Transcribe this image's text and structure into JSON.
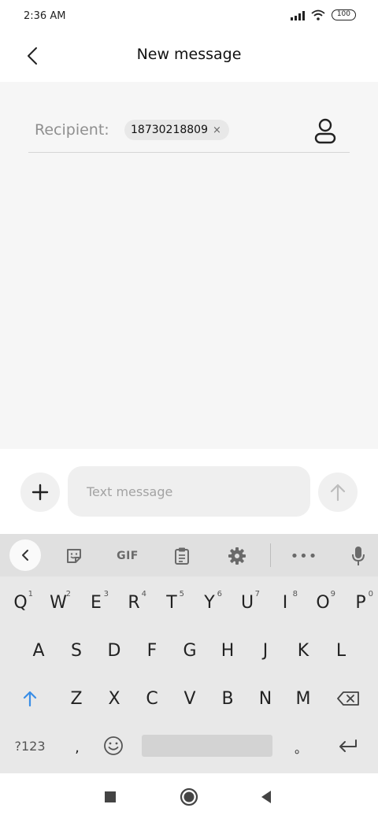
{
  "status_bar": {
    "time": "2:36 AM",
    "battery": "100"
  },
  "header": {
    "title": "New message"
  },
  "recipient": {
    "label": "Recipient:",
    "chip": "18730218809",
    "chip_remove": "×"
  },
  "composer": {
    "placeholder": "Text message"
  },
  "keyboard_toolbar": {
    "gif_label": "GIF",
    "more_label": "•••"
  },
  "keyboard": {
    "row1": [
      {
        "k": "Q",
        "n": "1"
      },
      {
        "k": "W",
        "n": "2"
      },
      {
        "k": "E",
        "n": "3"
      },
      {
        "k": "R",
        "n": "4"
      },
      {
        "k": "T",
        "n": "5"
      },
      {
        "k": "Y",
        "n": "6"
      },
      {
        "k": "U",
        "n": "7"
      },
      {
        "k": "I",
        "n": "8"
      },
      {
        "k": "O",
        "n": "9"
      },
      {
        "k": "P",
        "n": "0"
      }
    ],
    "row2": [
      "A",
      "S",
      "D",
      "F",
      "G",
      "H",
      "J",
      "K",
      "L"
    ],
    "row3": [
      "Z",
      "X",
      "C",
      "V",
      "B",
      "N",
      "M"
    ],
    "symbols_label": "?123",
    "comma": ",",
    "period": "。"
  },
  "colors": {
    "accent": "#3a8ee6",
    "background": "#f6f6f6"
  }
}
